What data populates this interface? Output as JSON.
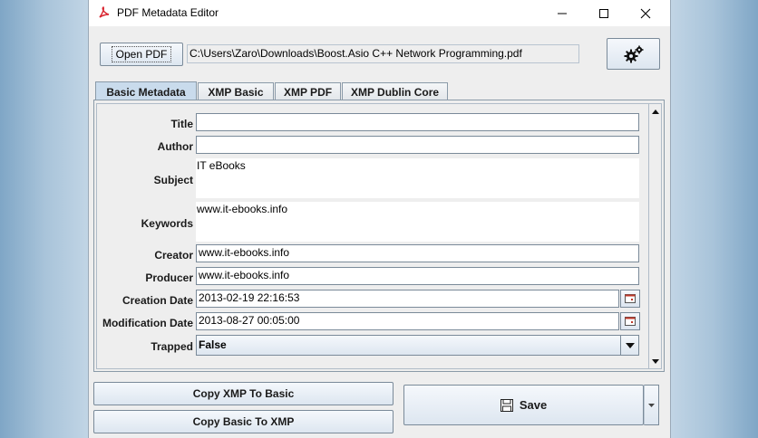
{
  "window": {
    "title": "PDF Metadata Editor"
  },
  "toolbar": {
    "open_pdf_label": "Open PDF",
    "file_path": "C:\\Users\\Zaro\\Downloads\\Boost.Asio C++ Network Programming.pdf"
  },
  "tabs": [
    {
      "label": "Basic Metadata",
      "active": true
    },
    {
      "label": "XMP Basic",
      "active": false
    },
    {
      "label": "XMP PDF",
      "active": false
    },
    {
      "label": "XMP Dublin Core",
      "active": false
    }
  ],
  "form": {
    "title": {
      "label": "Title",
      "value": ""
    },
    "author": {
      "label": "Author",
      "value": ""
    },
    "subject": {
      "label": "Subject",
      "value": "IT eBooks"
    },
    "keywords": {
      "label": "Keywords",
      "value": "www.it-ebooks.info"
    },
    "creator": {
      "label": "Creator",
      "value": "www.it-ebooks.info"
    },
    "producer": {
      "label": "Producer",
      "value": "www.it-ebooks.info"
    },
    "creation_date": {
      "label": "Creation Date",
      "value": "2013-02-19 22:16:53"
    },
    "modification_date": {
      "label": "Modification Date",
      "value": "2013-08-27 00:05:00"
    },
    "trapped": {
      "label": "Trapped",
      "value": "False"
    }
  },
  "actions": {
    "copy_xmp_to_basic": "Copy XMP To Basic",
    "copy_basic_to_xmp": "Copy Basic To XMP",
    "save": "Save"
  },
  "icons": {
    "app": "pdf-icon",
    "settings": "gear-icon",
    "save": "floppy-disk-icon",
    "calendar": "calendar-icon"
  },
  "colors": {
    "active_tab": "#c9dbec",
    "window_bg": "#eeeeee",
    "pdf_red": "#d9232e"
  }
}
